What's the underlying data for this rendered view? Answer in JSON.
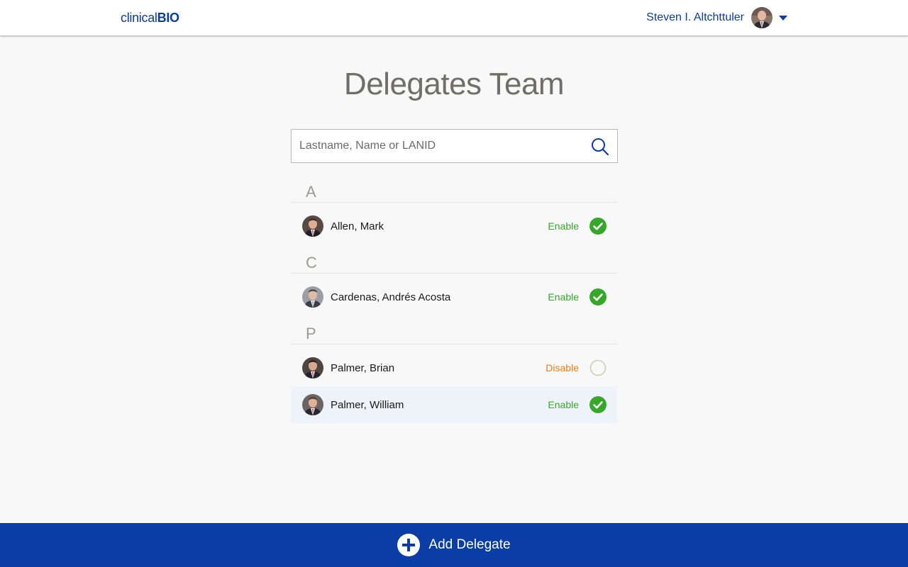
{
  "header": {
    "logo_light": "clinical",
    "logo_bold": "BIO",
    "user_name": "Steven I. Altchttuler"
  },
  "page": {
    "title": "Delegates Team"
  },
  "search": {
    "placeholder": "Lastname, Name or LANID",
    "value": ""
  },
  "groups": [
    {
      "letter": "A",
      "delegates": [
        {
          "name": "Allen, Mark",
          "status": "Enable",
          "enabled": true
        }
      ]
    },
    {
      "letter": "C",
      "delegates": [
        {
          "name": "Cardenas, Andrés Acosta",
          "status": "Enable",
          "enabled": true
        }
      ]
    },
    {
      "letter": "P",
      "delegates": [
        {
          "name": "Palmer, Brian",
          "status": "Disable",
          "enabled": false
        },
        {
          "name": "Palmer, William",
          "status": "Enable",
          "enabled": true,
          "highlighted": true
        }
      ]
    }
  ],
  "footer": {
    "add_label": "Add Delegate"
  },
  "colors": {
    "brand": "#0a3da6",
    "enable": "#35a82a",
    "disable": "#f07d10",
    "title": "#6f6f68"
  }
}
